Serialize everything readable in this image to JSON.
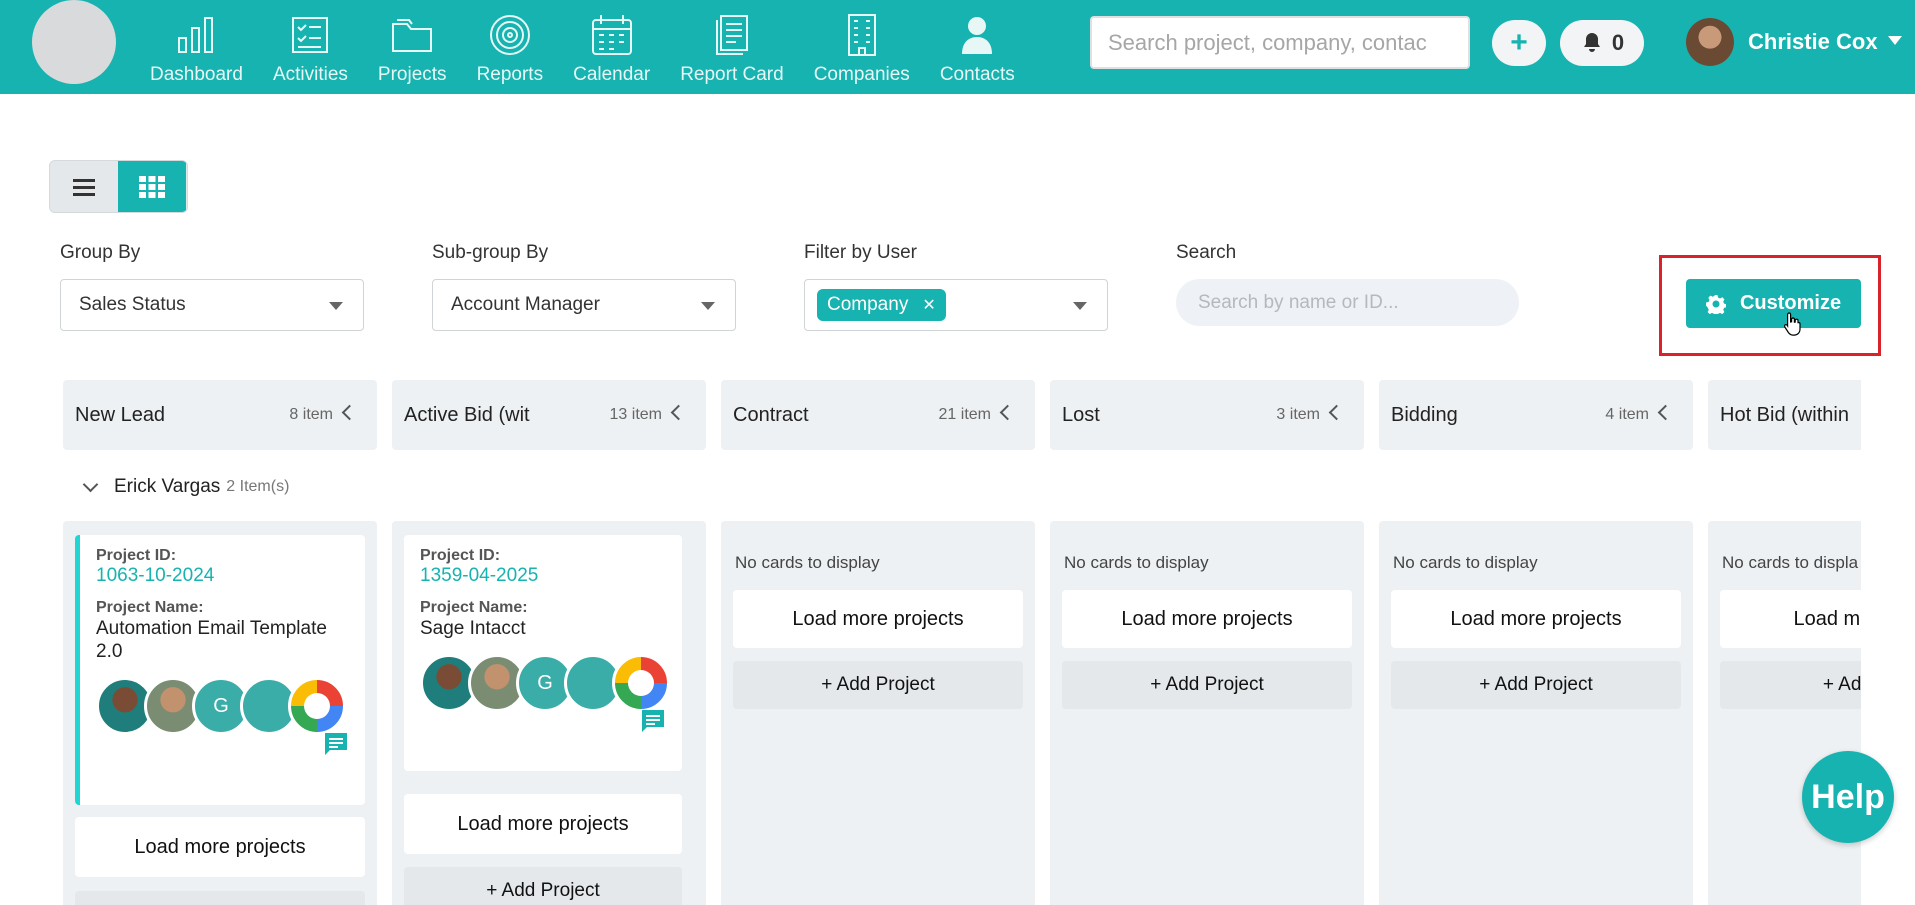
{
  "nav": {
    "items": [
      {
        "label": "Dashboard",
        "icon": "bar-chart-icon"
      },
      {
        "label": "Activities",
        "icon": "checklist-icon"
      },
      {
        "label": "Projects",
        "icon": "folder-icon"
      },
      {
        "label": "Reports",
        "icon": "target-icon"
      },
      {
        "label": "Calendar",
        "icon": "calendar-icon"
      },
      {
        "label": "Report Card",
        "icon": "document-icon"
      },
      {
        "label": "Companies",
        "icon": "building-icon"
      },
      {
        "label": "Contacts",
        "icon": "person-icon"
      }
    ]
  },
  "header": {
    "search_placeholder": "Search project, company, contac",
    "notifications_count": "0",
    "user_name": "Christie Cox"
  },
  "filters": {
    "group_by_label": "Group By",
    "group_by_value": "Sales Status",
    "subgroup_label": "Sub-group By",
    "subgroup_value": "Account Manager",
    "filter_user_label": "Filter by User",
    "filter_user_chip": "Company",
    "search_label": "Search",
    "search_placeholder": "Search by name or ID...",
    "customize_label": "Customize"
  },
  "board": {
    "columns": [
      {
        "title": "New Lead",
        "count": "8 item"
      },
      {
        "title": "Active Bid (wit",
        "count": "13 item"
      },
      {
        "title": "Contract",
        "count": "21 item"
      },
      {
        "title": "Lost",
        "count": "3 item"
      },
      {
        "title": "Bidding",
        "count": "4 item"
      },
      {
        "title": "Hot Bid (within",
        "count": ""
      }
    ],
    "subgroup": {
      "name": "Erick Vargas",
      "count": "2 Item(s)"
    },
    "cards": [
      {
        "id_label": "Project ID:",
        "id": "1063-10-2024",
        "name_label": "Project Name:",
        "name": "Automation Email Template 2.0",
        "initial": "G"
      },
      {
        "id_label": "Project ID:",
        "id": "1359-04-2025",
        "name_label": "Project Name:",
        "name": "Sage Intacct",
        "initial": "G"
      }
    ],
    "no_cards": "No cards to display",
    "no_cards_cut": "No cards to displa",
    "load_more": "Load more projects",
    "load_more_cut": "Load mor",
    "add_project": "+ Add Project",
    "add_project_cut": "+ Add"
  },
  "help_label": "Help",
  "colors": {
    "brand": "#16b3b0",
    "highlight": "#d8232a"
  }
}
